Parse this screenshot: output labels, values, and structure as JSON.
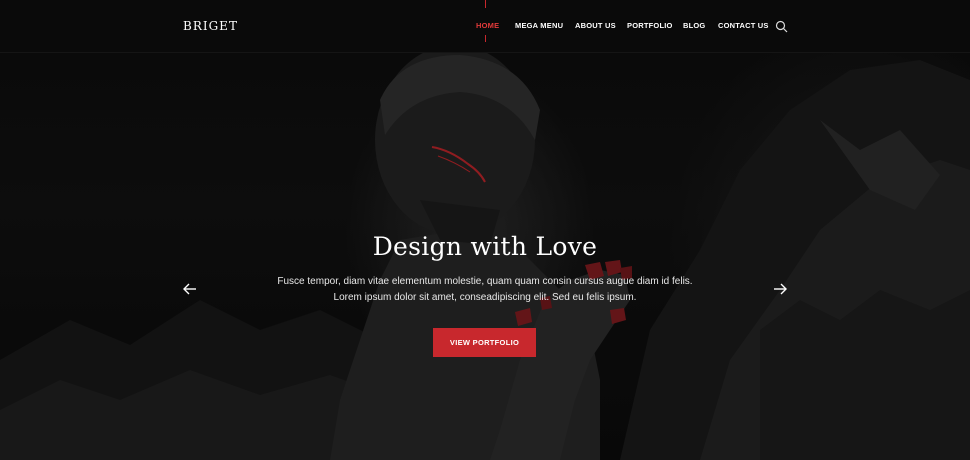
{
  "brand": {
    "logo_text": "BRIGET"
  },
  "nav": {
    "items": [
      {
        "label": "HOME",
        "active": true
      },
      {
        "label": "MEGA MENU"
      },
      {
        "label": "ABOUT US"
      },
      {
        "label": "PORTFOLIO"
      },
      {
        "label": "BLOG"
      },
      {
        "label": "CONTACT US"
      }
    ],
    "search_icon": "search-icon"
  },
  "hero": {
    "title": "Design with Love",
    "text_line_1": "Fusce tempor, diam vitae elementum molestie, quam quam consin cursus augue diam id felis.",
    "text_line_2": "Lorem ipsum dolor sit amet, conseadipiscing elit. Sed eu felis ipsum.",
    "cta_label": "VIEW PORTFOLIO",
    "prev_icon": "arrow-left-icon",
    "next_icon": "arrow-right-icon"
  },
  "colors": {
    "accent": "#c8282d",
    "nav_background": "#0a0a0a",
    "hero_background": "#0e0e0e",
    "text": "#ffffff"
  }
}
